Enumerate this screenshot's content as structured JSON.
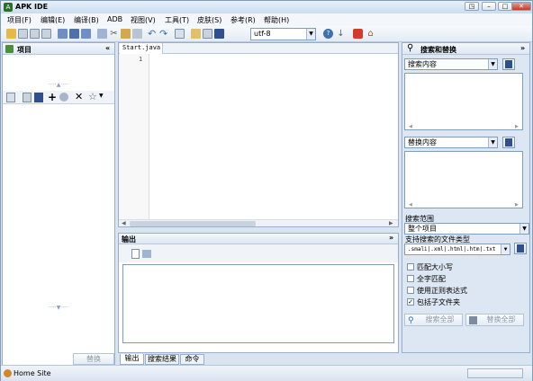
{
  "window": {
    "title": "APK IDE"
  },
  "menu": [
    "项目(F)",
    "编辑(E)",
    "编译(B)",
    "ADB",
    "视图(V)",
    "工具(T)",
    "皮肤(S)",
    "参考(R)",
    "帮助(H)"
  ],
  "toolbar": {
    "encoding": "utf-8"
  },
  "project": {
    "title": "项目",
    "collapse": "«",
    "replace_button": "替换"
  },
  "editor": {
    "tab": "Start.java",
    "line_number": "1"
  },
  "output": {
    "title": "输出",
    "collapse": "»",
    "tabs": [
      "输出",
      "搜索结果",
      "命令"
    ]
  },
  "search": {
    "title": "搜索和替换",
    "collapse": "»",
    "find_combo": "搜索内容",
    "replace_combo": "替换内容",
    "scope_label": "搜索范围",
    "scope_value": "整个项目",
    "filetypes_label": "支持搜索的文件类型",
    "filetypes_value": ".smali|.xml|.html|.htm|.txt",
    "options": [
      {
        "label": "匹配大小写",
        "checked": false
      },
      {
        "label": "全字匹配",
        "checked": false
      },
      {
        "label": "使用正则表达式",
        "checked": false
      },
      {
        "label": "包括子文件夹",
        "checked": true
      }
    ],
    "search_all": "搜索全部",
    "replace_all": "替换全部"
  },
  "status": {
    "text": "Home Site"
  },
  "colors": {
    "accent": "#3d6fb4",
    "frame": "#d9e4f1",
    "border": "#99aecb"
  }
}
